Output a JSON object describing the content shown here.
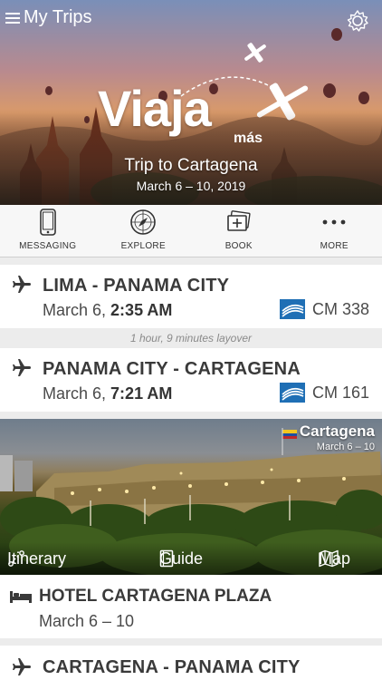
{
  "header": {
    "menu_label": "My Trips",
    "logo_word": "Viaja",
    "logo_sub": "más",
    "trip_title": "Trip to Cartagena",
    "trip_dates": "March 6 – 10, 2019"
  },
  "toolbar": {
    "items": [
      {
        "label": "MESSAGING",
        "icon": "phone-icon"
      },
      {
        "label": "EXPLORE",
        "icon": "compass-icon"
      },
      {
        "label": "BOOK",
        "icon": "book-icon"
      },
      {
        "label": "MORE",
        "icon": "more-icon"
      }
    ]
  },
  "flights": [
    {
      "route": "LIMA - PANAMA CITY",
      "date": "March 6,",
      "time": "2:35 AM",
      "flight": "CM 338"
    },
    {
      "route": "PANAMA CITY - CARTAGENA",
      "date": "March 6,",
      "time": "7:21 AM",
      "flight": "CM 161"
    },
    {
      "route": "CARTAGENA - PANAMA CITY"
    }
  ],
  "layover": "1 hour, 9 minutes layover",
  "destination": {
    "name": "Cartagena",
    "dates": "March 6 – 10",
    "links": {
      "itinerary": "Itinerary",
      "guide": "Guide",
      "map": "Map"
    }
  },
  "hotel": {
    "name": "HOTEL CARTAGENA PLAZA",
    "dates": "March 6 – 10"
  },
  "colors": {
    "airline_blue": "#1f6fb5",
    "text_dark": "#3a3a3a",
    "separator": "#ececec"
  }
}
